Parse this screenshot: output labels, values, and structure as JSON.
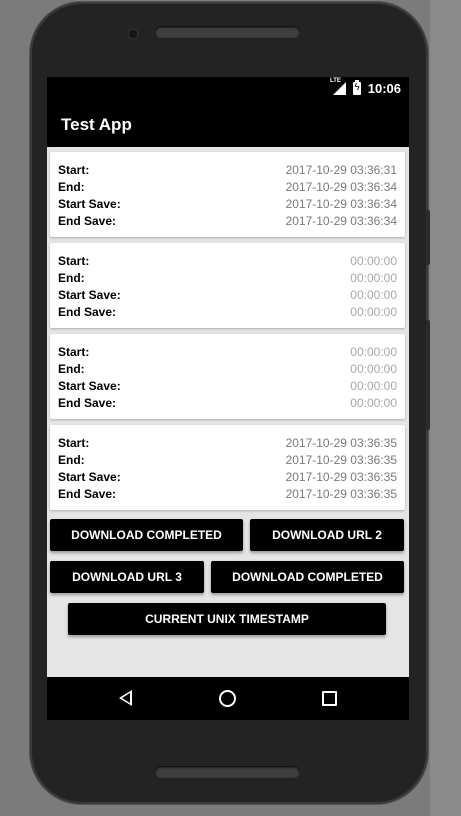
{
  "status_bar": {
    "network": "LTE",
    "time": "10:06"
  },
  "app_bar": {
    "title": "Test App"
  },
  "labels": {
    "start": "Start:",
    "end": "End:",
    "start_save": "Start Save:",
    "end_save": "End Save:"
  },
  "cards": [
    {
      "start": "2017-10-29 03:36:31",
      "end": "2017-10-29 03:36:34",
      "start_save": "2017-10-29 03:36:34",
      "end_save": "2017-10-29 03:36:34"
    },
    {
      "start": "00:00:00",
      "end": "00:00:00",
      "start_save": "00:00:00",
      "end_save": "00:00:00"
    },
    {
      "start": "00:00:00",
      "end": "00:00:00",
      "start_save": "00:00:00",
      "end_save": "00:00:00"
    },
    {
      "start": "2017-10-29 03:36:35",
      "end": "2017-10-29 03:36:35",
      "start_save": "2017-10-29 03:36:35",
      "end_save": "2017-10-29 03:36:35"
    }
  ],
  "buttons": {
    "download_completed_1": "DOWNLOAD COMPLETED",
    "download_url_2": "DOWNLOAD URL 2",
    "download_url_3": "DOWNLOAD URL 3",
    "download_completed_2": "DOWNLOAD COMPLETED",
    "current_unix_timestamp": "CURRENT UNIX TIMESTAMP"
  },
  "nav": {
    "back_icon": "back-triangle-icon",
    "home_icon": "home-circle-icon",
    "recents_icon": "recents-square-icon"
  },
  "colors": {
    "app_bar": "#000000",
    "screen_bg": "#e5e5e5",
    "button_bg": "#000000",
    "value_text": "#7a7a7a"
  }
}
